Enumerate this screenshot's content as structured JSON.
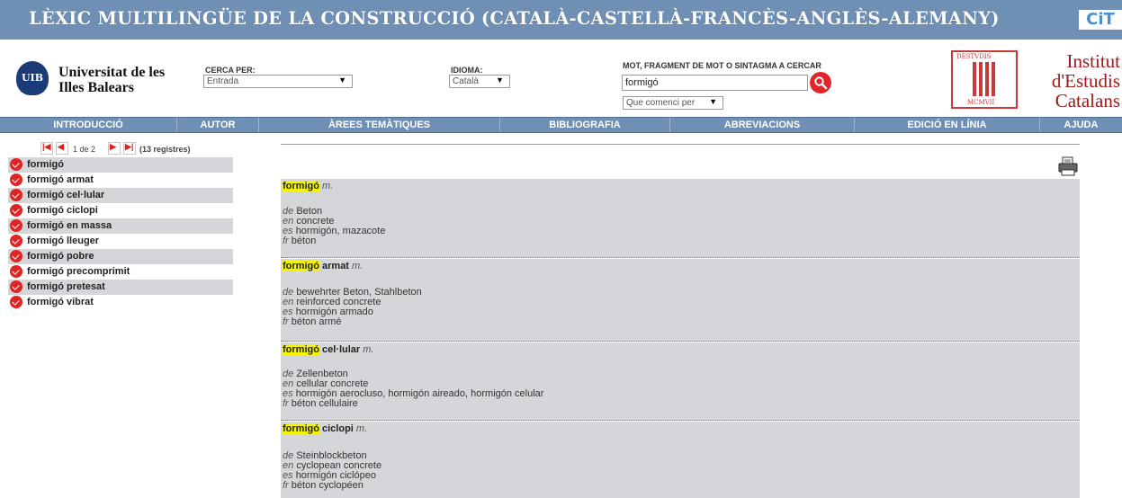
{
  "header": {
    "title": "LÈXIC MULTILINGÜE DE LA CONSTRUCCIÓ (CATALÀ-CASTELLÀ-FRANCÈS-ANGLÈS-ALEMANY)",
    "cit_logo": "CiT"
  },
  "uib": {
    "logo_text": "UIB",
    "name_line1": "Universitat de les",
    "name_line2": "Illes Balears"
  },
  "search": {
    "cerca_label": "CERCA PER:",
    "cerca_value": "Entrada",
    "idioma_label": "IDIOMA:",
    "idioma_value": "Català",
    "query_label": "MOT, FRAGMENT DE MOT O SINTAGMA A CERCAR",
    "query_value": "formigó",
    "mode_value": "Que comenci per"
  },
  "iec": {
    "seal_top": "DESTVDIS",
    "seal_bottom": "MCMVII",
    "name_line1": "Institut",
    "name_line2": "d'Estudis",
    "name_line3": "Catalans"
  },
  "menu": [
    "INTRODUCCIÓ",
    "AUTOR",
    "ÀREES TEMÀTIQUES",
    "BIBLIOGRAFIA",
    "ABREVIACIONS",
    "EDICIÓ EN LÍNIA",
    "AJUDA"
  ],
  "pager": {
    "page_text": "1 de 2",
    "count_text": "(13 registres)"
  },
  "results": [
    "formigó",
    "formigó armat",
    "formigó cel·lular",
    "formigó ciclopi",
    "formigó en massa",
    "formigó lleuger",
    "formigó pobre",
    "formigó precomprimit",
    "formigó pretesat",
    "formigó vibrat"
  ],
  "entries": [
    {
      "highlight": "formigó",
      "rest": "",
      "gram": "m.",
      "translations": [
        {
          "lang": "de",
          "text": "Beton"
        },
        {
          "lang": "en",
          "text": "concrete"
        },
        {
          "lang": "es",
          "text": "hormigón, mazacote"
        },
        {
          "lang": "fr",
          "text": "béton"
        }
      ]
    },
    {
      "highlight": "formigó",
      "rest": " armat",
      "gram": "m.",
      "translations": [
        {
          "lang": "de",
          "text": "bewehrter Beton, Stahlbeton"
        },
        {
          "lang": "en",
          "text": "reinforced concrete"
        },
        {
          "lang": "es",
          "text": "hormigón armado"
        },
        {
          "lang": "fr",
          "text": "béton armé"
        }
      ]
    },
    {
      "highlight": "formigó",
      "rest": " cel·lular",
      "gram": "m.",
      "translations": [
        {
          "lang": "de",
          "text": "Zellenbeton"
        },
        {
          "lang": "en",
          "text": "cellular concrete"
        },
        {
          "lang": "es",
          "text": "hormigón aerocluso, hormigón aireado, hormigón celular"
        },
        {
          "lang": "fr",
          "text": "béton cellulaire"
        }
      ]
    },
    {
      "highlight": "formigó",
      "rest": " ciclopi",
      "gram": "m.",
      "translations": [
        {
          "lang": "de",
          "text": "Steinblockbeton"
        },
        {
          "lang": "en",
          "text": "cyclopean concrete"
        },
        {
          "lang": "es",
          "text": "hormigón ciclópeo"
        },
        {
          "lang": "fr",
          "text": "béton cyclopéen"
        }
      ]
    }
  ],
  "colors": {
    "bar": "#6f8fb4",
    "row_grey": "#d4d6d9",
    "highlight": "#f4f400",
    "accent_red": "#e02424"
  }
}
